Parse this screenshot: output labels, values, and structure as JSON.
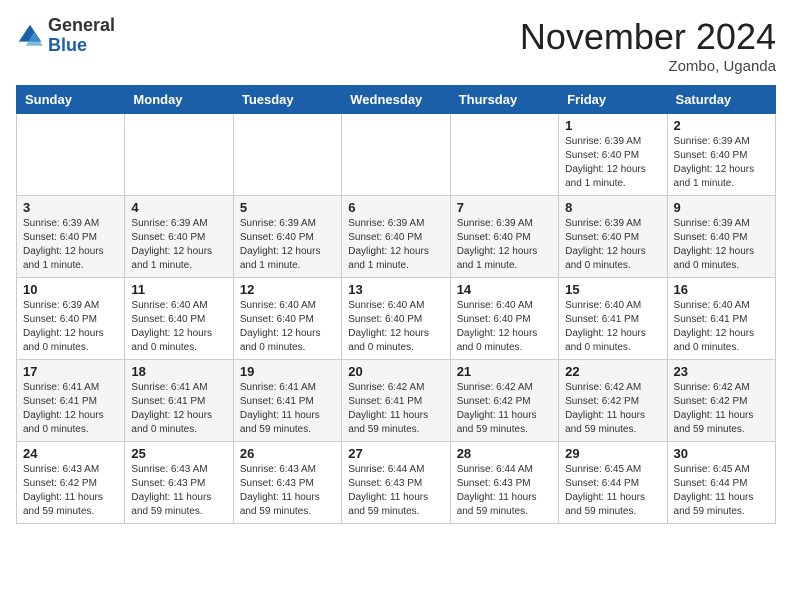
{
  "logo": {
    "general": "General",
    "blue": "Blue"
  },
  "title": "November 2024",
  "location": "Zombo, Uganda",
  "days_of_week": [
    "Sunday",
    "Monday",
    "Tuesday",
    "Wednesday",
    "Thursday",
    "Friday",
    "Saturday"
  ],
  "weeks": [
    [
      {
        "day": "",
        "info": ""
      },
      {
        "day": "",
        "info": ""
      },
      {
        "day": "",
        "info": ""
      },
      {
        "day": "",
        "info": ""
      },
      {
        "day": "",
        "info": ""
      },
      {
        "day": "1",
        "info": "Sunrise: 6:39 AM\nSunset: 6:40 PM\nDaylight: 12 hours and 1 minute."
      },
      {
        "day": "2",
        "info": "Sunrise: 6:39 AM\nSunset: 6:40 PM\nDaylight: 12 hours and 1 minute."
      }
    ],
    [
      {
        "day": "3",
        "info": "Sunrise: 6:39 AM\nSunset: 6:40 PM\nDaylight: 12 hours and 1 minute."
      },
      {
        "day": "4",
        "info": "Sunrise: 6:39 AM\nSunset: 6:40 PM\nDaylight: 12 hours and 1 minute."
      },
      {
        "day": "5",
        "info": "Sunrise: 6:39 AM\nSunset: 6:40 PM\nDaylight: 12 hours and 1 minute."
      },
      {
        "day": "6",
        "info": "Sunrise: 6:39 AM\nSunset: 6:40 PM\nDaylight: 12 hours and 1 minute."
      },
      {
        "day": "7",
        "info": "Sunrise: 6:39 AM\nSunset: 6:40 PM\nDaylight: 12 hours and 1 minute."
      },
      {
        "day": "8",
        "info": "Sunrise: 6:39 AM\nSunset: 6:40 PM\nDaylight: 12 hours and 0 minutes."
      },
      {
        "day": "9",
        "info": "Sunrise: 6:39 AM\nSunset: 6:40 PM\nDaylight: 12 hours and 0 minutes."
      }
    ],
    [
      {
        "day": "10",
        "info": "Sunrise: 6:39 AM\nSunset: 6:40 PM\nDaylight: 12 hours and 0 minutes."
      },
      {
        "day": "11",
        "info": "Sunrise: 6:40 AM\nSunset: 6:40 PM\nDaylight: 12 hours and 0 minutes."
      },
      {
        "day": "12",
        "info": "Sunrise: 6:40 AM\nSunset: 6:40 PM\nDaylight: 12 hours and 0 minutes."
      },
      {
        "day": "13",
        "info": "Sunrise: 6:40 AM\nSunset: 6:40 PM\nDaylight: 12 hours and 0 minutes."
      },
      {
        "day": "14",
        "info": "Sunrise: 6:40 AM\nSunset: 6:40 PM\nDaylight: 12 hours and 0 minutes."
      },
      {
        "day": "15",
        "info": "Sunrise: 6:40 AM\nSunset: 6:41 PM\nDaylight: 12 hours and 0 minutes."
      },
      {
        "day": "16",
        "info": "Sunrise: 6:40 AM\nSunset: 6:41 PM\nDaylight: 12 hours and 0 minutes."
      }
    ],
    [
      {
        "day": "17",
        "info": "Sunrise: 6:41 AM\nSunset: 6:41 PM\nDaylight: 12 hours and 0 minutes."
      },
      {
        "day": "18",
        "info": "Sunrise: 6:41 AM\nSunset: 6:41 PM\nDaylight: 12 hours and 0 minutes."
      },
      {
        "day": "19",
        "info": "Sunrise: 6:41 AM\nSunset: 6:41 PM\nDaylight: 11 hours and 59 minutes."
      },
      {
        "day": "20",
        "info": "Sunrise: 6:42 AM\nSunset: 6:41 PM\nDaylight: 11 hours and 59 minutes."
      },
      {
        "day": "21",
        "info": "Sunrise: 6:42 AM\nSunset: 6:42 PM\nDaylight: 11 hours and 59 minutes."
      },
      {
        "day": "22",
        "info": "Sunrise: 6:42 AM\nSunset: 6:42 PM\nDaylight: 11 hours and 59 minutes."
      },
      {
        "day": "23",
        "info": "Sunrise: 6:42 AM\nSunset: 6:42 PM\nDaylight: 11 hours and 59 minutes."
      }
    ],
    [
      {
        "day": "24",
        "info": "Sunrise: 6:43 AM\nSunset: 6:42 PM\nDaylight: 11 hours and 59 minutes."
      },
      {
        "day": "25",
        "info": "Sunrise: 6:43 AM\nSunset: 6:43 PM\nDaylight: 11 hours and 59 minutes."
      },
      {
        "day": "26",
        "info": "Sunrise: 6:43 AM\nSunset: 6:43 PM\nDaylight: 11 hours and 59 minutes."
      },
      {
        "day": "27",
        "info": "Sunrise: 6:44 AM\nSunset: 6:43 PM\nDaylight: 11 hours and 59 minutes."
      },
      {
        "day": "28",
        "info": "Sunrise: 6:44 AM\nSunset: 6:43 PM\nDaylight: 11 hours and 59 minutes."
      },
      {
        "day": "29",
        "info": "Sunrise: 6:45 AM\nSunset: 6:44 PM\nDaylight: 11 hours and 59 minutes."
      },
      {
        "day": "30",
        "info": "Sunrise: 6:45 AM\nSunset: 6:44 PM\nDaylight: 11 hours and 59 minutes."
      }
    ]
  ]
}
